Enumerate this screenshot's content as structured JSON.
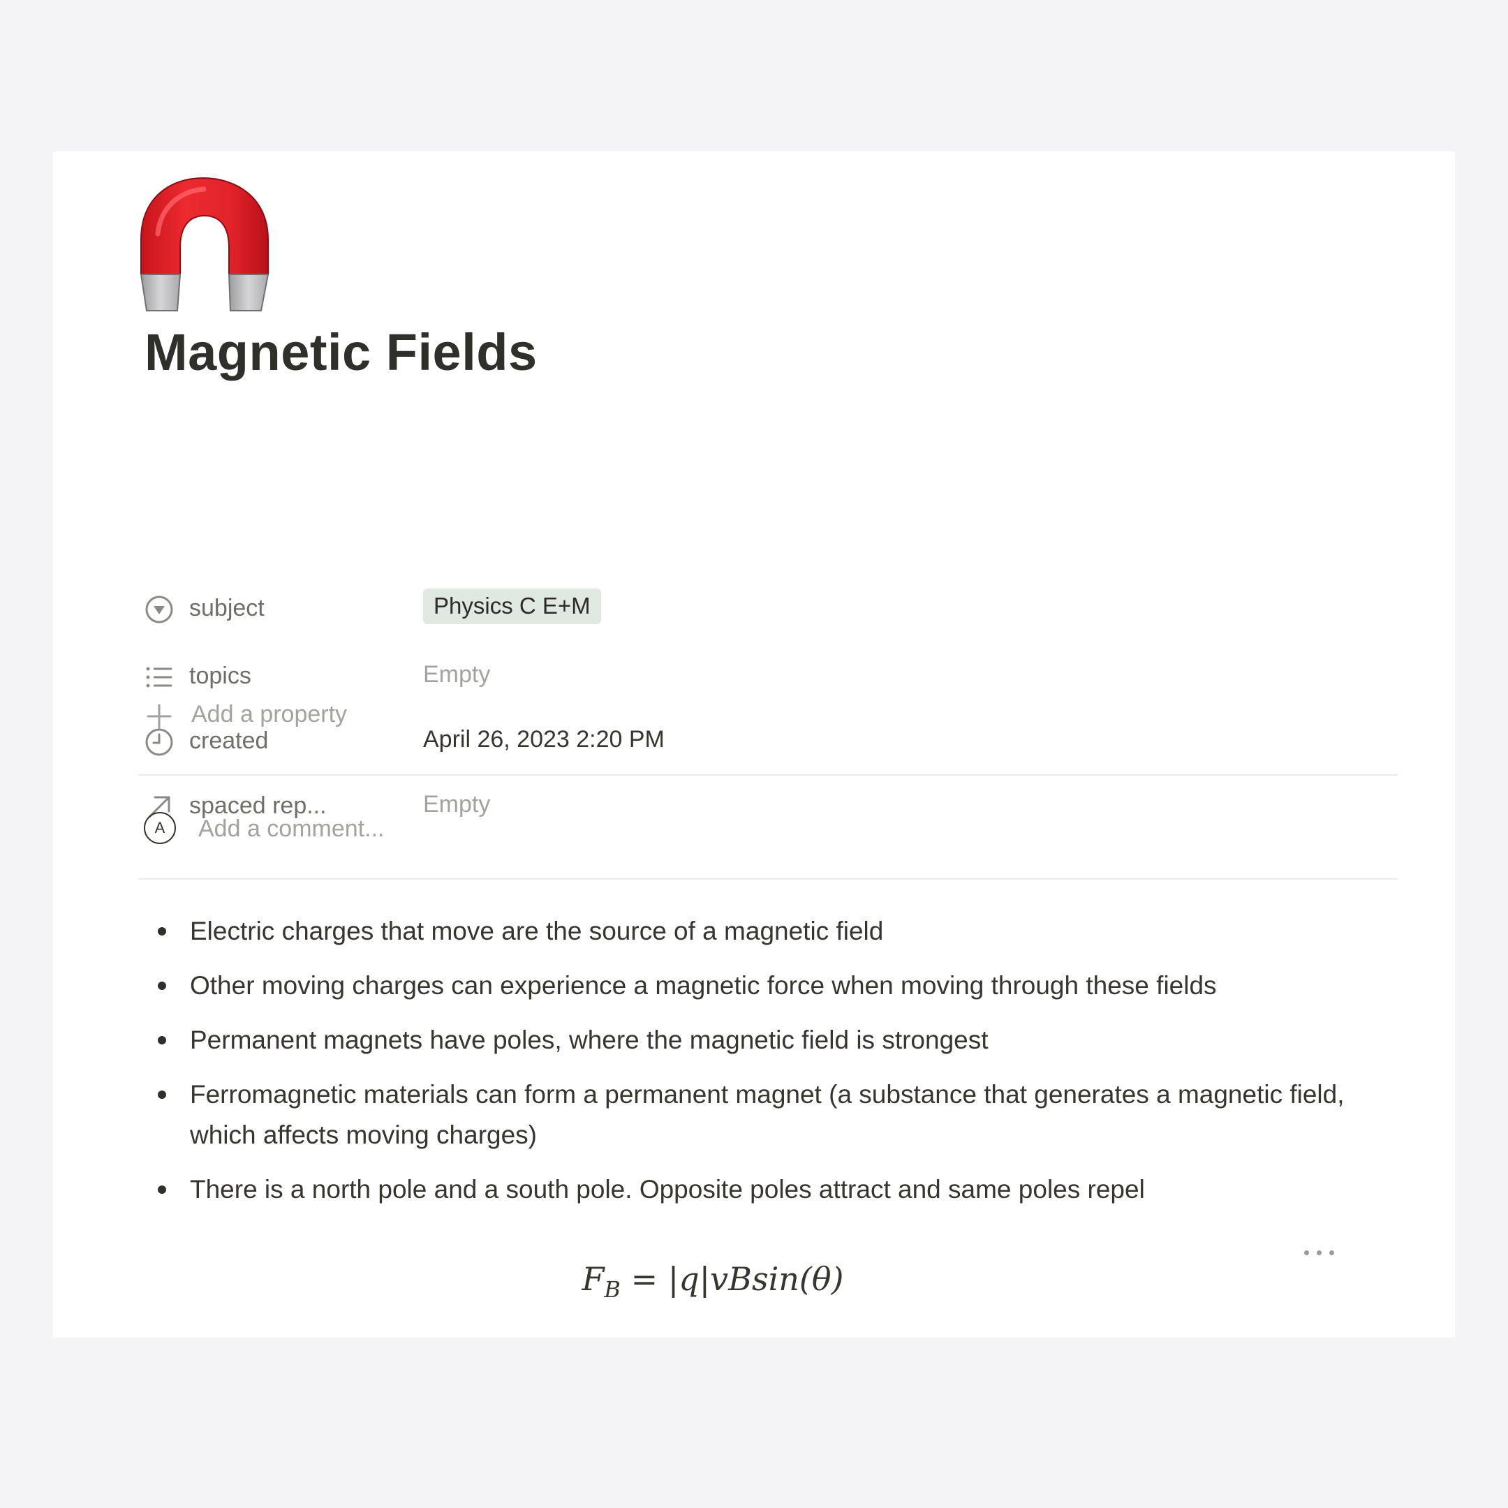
{
  "page": {
    "icon": "horseshoe-magnet-icon",
    "title": "Magnetic Fields"
  },
  "properties": [
    {
      "icon": "select-icon",
      "label": "subject",
      "value": "Physics C E+M",
      "type": "tag",
      "tag_color": "#dfe9e2"
    },
    {
      "icon": "list-icon",
      "label": "topics",
      "value": "Empty",
      "type": "empty"
    },
    {
      "icon": "clock-icon",
      "label": "created",
      "value": "April 26, 2023 2:20 PM",
      "type": "text"
    },
    {
      "icon": "relation-arrow-icon",
      "label": "spaced rep...",
      "value": "Empty",
      "type": "empty"
    }
  ],
  "add_property_label": "Add a property",
  "comment": {
    "avatar_initial": "A",
    "placeholder": "Add a comment..."
  },
  "bullets": [
    "Electric charges that move are the source of a magnetic field",
    "Other moving charges can experience a magnetic force when moving through these fields",
    "Permanent magnets have poles, where the magnetic field is strongest",
    "Ferromagnetic materials can form a permanent magnet (a substance that generates a magnetic field, which affects moving charges)",
    "There is a north pole and a south pole. Opposite poles attract and same poles repel"
  ],
  "equation": {
    "lhs": "F",
    "lhs_sub": "B",
    "rhs": "= |q|vBsin(θ)"
  },
  "colors": {
    "background": "#f4f3f5",
    "card": "#ffffff",
    "text": "#37352f",
    "muted": "#a3a29e",
    "magnet_red": "#e3232b"
  }
}
